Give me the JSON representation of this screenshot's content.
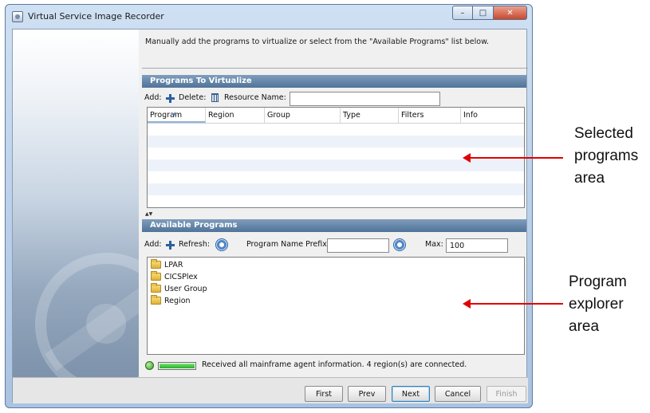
{
  "window": {
    "title": "Virtual Service Image Recorder",
    "controls": {
      "minimize": "–",
      "maximize": "□",
      "close": "✕"
    }
  },
  "instruction": "Manually add the programs to virtualize or select from the \"Available Programs\" list below.",
  "programs_to_virtualize": {
    "title": "Programs To Virtualize",
    "add_label": "Add:",
    "delete_label": "Delete:",
    "resource_name_label": "Resource Name:",
    "resource_name_value": "",
    "columns": [
      "Program",
      "Region",
      "Group",
      "Type",
      "Filters",
      "Info"
    ],
    "sorted_column": "Program",
    "rows": []
  },
  "available_programs": {
    "title": "Available Programs",
    "add_label": "Add:",
    "refresh_label": "Refresh:",
    "prefix_label": "Program Name Prefix:",
    "prefix_value": "",
    "max_label": "Max:",
    "max_value": "100",
    "tree": [
      "LPAR",
      "CICSPlex",
      "User Group",
      "Region"
    ]
  },
  "status": {
    "progress": 1.0,
    "message": "Received all mainframe agent information. 4 region(s) are connected."
  },
  "buttons": {
    "first": "First",
    "prev": "Prev",
    "next": "Next",
    "cancel": "Cancel",
    "finish": "Finish"
  },
  "annotations": {
    "selected": [
      "Selected",
      "programs",
      "area"
    ],
    "explorer": [
      "Program",
      "explorer",
      "area"
    ]
  },
  "colors": {
    "header_blue": "#4f7398",
    "arrow_red": "#e00000",
    "progress_green": "#22b022"
  }
}
